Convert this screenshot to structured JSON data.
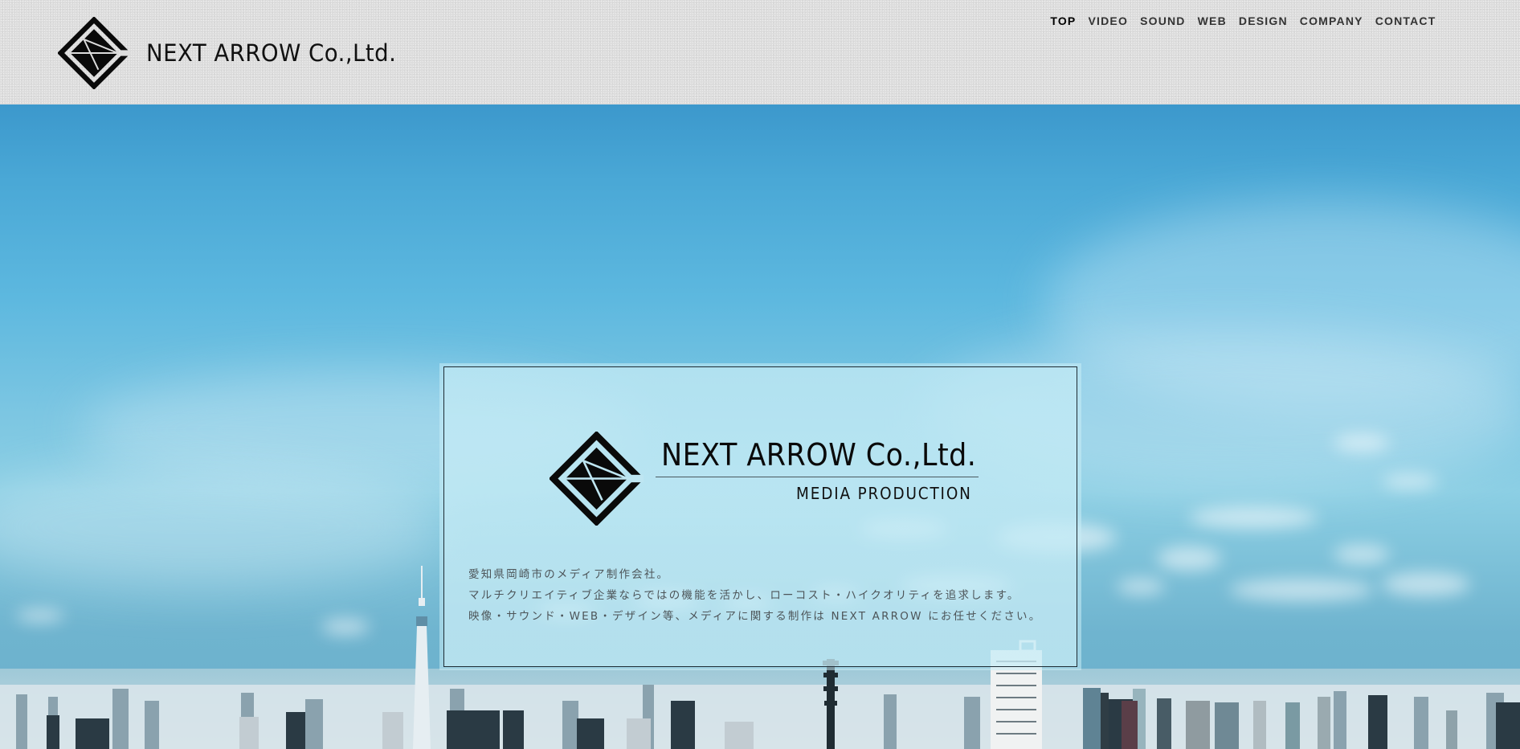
{
  "header": {
    "brand_name": "NEXT ARROW Co.,Ltd.",
    "logo_icon": "diamond-arrow-logo-icon",
    "nav": [
      {
        "label": "TOP",
        "active": true
      },
      {
        "label": "VIDEO",
        "active": false
      },
      {
        "label": "SOUND",
        "active": false
      },
      {
        "label": "WEB",
        "active": false
      },
      {
        "label": "DESIGN",
        "active": false
      },
      {
        "label": "COMPANY",
        "active": false
      },
      {
        "label": "CONTACT",
        "active": false
      }
    ]
  },
  "hero": {
    "background": "city-skyline-blue-sky-photo",
    "card": {
      "title": "NEXT ARROW Co.,Ltd.",
      "subtitle": "MEDIA PRODUCTION",
      "description": [
        "愛知県岡崎市のメディア制作会社。",
        "マルチクリエイティブ企業ならではの機能を活かし、ローコスト・ハイクオリティを追求します。",
        "映像・サウンド・WEB・デザイン等、メディアに関する制作は NEXT ARROW にお任せください。"
      ]
    }
  },
  "colors": {
    "header_bg": "#dcdcdc",
    "nav_text": "#333333",
    "sky_top": "#3c98cc",
    "sky_mid": "#8ccfe4",
    "card_border": "#1d2b33",
    "logo": "#0a0a0a"
  }
}
